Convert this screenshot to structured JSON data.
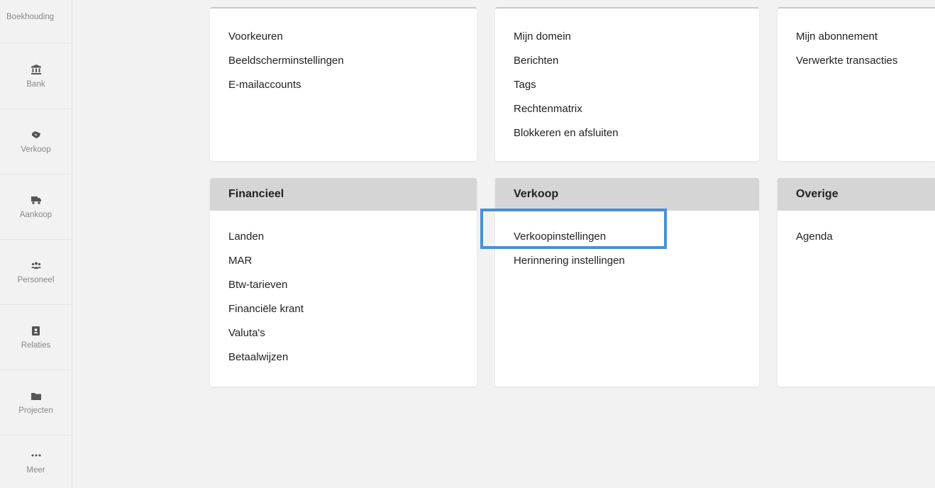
{
  "sidebar": {
    "top_label": "Boekhouding",
    "items": [
      {
        "label": "Bank",
        "icon": "bank-icon"
      },
      {
        "label": "Verkoop",
        "icon": "handshake-icon"
      },
      {
        "label": "Aankoop",
        "icon": "truck-icon"
      },
      {
        "label": "Personeel",
        "icon": "users-icon"
      },
      {
        "label": "Relaties",
        "icon": "address-book-icon"
      },
      {
        "label": "Projecten",
        "icon": "folder-icon"
      },
      {
        "label": "Meer",
        "icon": "ellipsis-icon"
      }
    ]
  },
  "cards_top": [
    {
      "links": [
        "Voorkeuren",
        "Beeldscherminstellingen",
        "E-mailaccounts"
      ]
    },
    {
      "links": [
        "Mijn domein",
        "Berichten",
        "Tags",
        "Rechtenmatrix",
        "Blokkeren en afsluiten"
      ]
    },
    {
      "links": [
        "Mijn abonnement",
        "Verwerkte transacties"
      ]
    }
  ],
  "cards_bottom": [
    {
      "title": "Financieel",
      "links": [
        "Landen",
        "MAR",
        "Btw-tarieven",
        "Financiële krant",
        "Valuta's",
        "Betaalwijzen"
      ]
    },
    {
      "title": "Verkoop",
      "links": [
        "Verkoopinstellingen",
        "Herinnering instellingen"
      ]
    },
    {
      "title": "Overige",
      "links": [
        "Agenda"
      ]
    }
  ],
  "colors": {
    "highlight": "#4a8fd9",
    "header_bg": "#d5d5d5",
    "page_bg": "#f2f2f2"
  }
}
